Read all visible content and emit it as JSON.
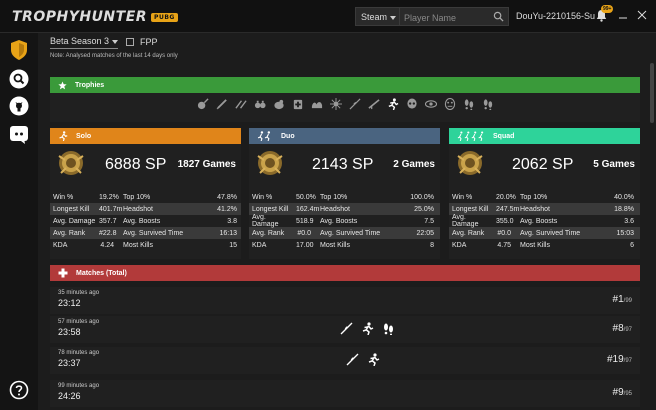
{
  "app": {
    "logo": "TROPHYHUNTER",
    "logo_badge": "PUBG"
  },
  "topbar": {
    "platform": "Steam",
    "search_placeholder": "Player Name",
    "username": "DouYu-2210156-Su",
    "notification_count": "99+"
  },
  "filters": {
    "season": "Beta Season 3",
    "fpp_label": "FPP",
    "note": "Note: Analysed matches of the last 14 days only"
  },
  "trophies": {
    "title": "Trophies",
    "icons": [
      "pan-icon",
      "syringe-icon",
      "rifle-pair-icon",
      "grenade-pair-icon",
      "chicken-icon",
      "medic-icon",
      "muscle-icon",
      "sunburst-icon",
      "sniper-icon",
      "rifle-icon",
      "runner-icon",
      "skull-icon",
      "eye-icon",
      "mask-icon",
      "footprints-icon",
      "footprints-icon"
    ]
  },
  "modes": [
    {
      "key": "solo",
      "title": "Solo",
      "color": "#e0851a",
      "sp": "6888 SP",
      "games": "1827 Games",
      "rows": [
        [
          "Win %",
          "19.2%",
          "Top 10%",
          "47.8%"
        ],
        [
          "Longest Kill",
          "401.7m",
          "Headshot",
          "41.2%"
        ],
        [
          "Avg. Damage",
          "357.7",
          "Avg. Boosts",
          "3.8"
        ],
        [
          "Avg. Rank",
          "#22.8",
          "Avg. Survived Time",
          "16:13"
        ],
        [
          "KDA",
          "4.24",
          "Most Kills",
          "15"
        ]
      ]
    },
    {
      "key": "duo",
      "title": "Duo",
      "color": "#4a6480",
      "sp": "2143 SP",
      "games": "2 Games",
      "rows": [
        [
          "Win %",
          "50.0%",
          "Top 10%",
          "100.0%"
        ],
        [
          "Longest Kill",
          "162.4m",
          "Headshot",
          "25.0%"
        ],
        [
          "Avg. Damage",
          "518.9",
          "Avg. Boosts",
          "7.5"
        ],
        [
          "Avg. Rank",
          "#0.0",
          "Avg. Survived Time",
          "22:05"
        ],
        [
          "KDA",
          "17.00",
          "Most Kills",
          "8"
        ]
      ]
    },
    {
      "key": "squad",
      "title": "Squad",
      "color": "#2ed39a",
      "sp": "2062 SP",
      "games": "5 Games",
      "rows": [
        [
          "Win %",
          "20.0%",
          "Top 10%",
          "40.0%"
        ],
        [
          "Longest Kill",
          "247.5m",
          "Headshot",
          "18.8%"
        ],
        [
          "Avg. Damage",
          "355.0",
          "Avg. Boosts",
          "3.6"
        ],
        [
          "Avg. Rank",
          "#0.0",
          "Avg. Survived Time",
          "15:03"
        ],
        [
          "KDA",
          "4.75",
          "Most Kills",
          "6"
        ]
      ]
    }
  ],
  "matches": {
    "title": "Matches (Total)",
    "items": [
      {
        "ago": "35 minutes ago",
        "duration": "23:12",
        "rank": "#1",
        "total": "/99",
        "icons": []
      },
      {
        "ago": "57 minutes ago",
        "duration": "23:58",
        "rank": "#8",
        "total": "/97",
        "icons": [
          "sniper-icon",
          "runner-icon",
          "footprints-icon"
        ]
      },
      {
        "ago": "78 minutes ago",
        "duration": "23:37",
        "rank": "#19",
        "total": "/97",
        "icons": [
          "sniper-icon",
          "runner-icon"
        ]
      },
      {
        "ago": "99 minutes ago",
        "duration": "24:26",
        "rank": "#9",
        "total": "/95",
        "icons": []
      }
    ]
  },
  "colors": {
    "trophies": "#3a9a3a",
    "matches": "#b23a3a",
    "accent": "#e8a317"
  }
}
